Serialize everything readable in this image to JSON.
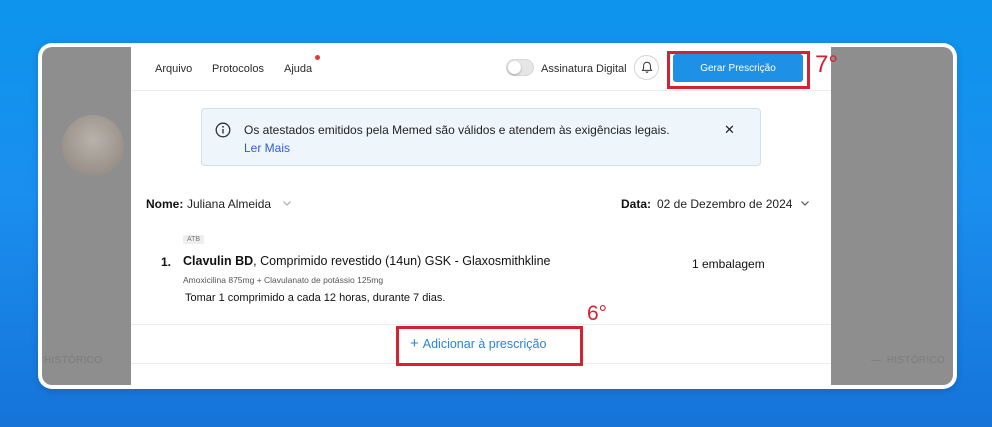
{
  "background": {
    "left_label": "HISTÓRICO",
    "right_label": "HISTÓRICO",
    "right_dash": "—"
  },
  "header": {
    "menu": [
      {
        "label": "Arquivo"
      },
      {
        "label": "Protocolos"
      },
      {
        "label": "Ajuda",
        "notification": true
      }
    ],
    "signature_label": "Assinatura Digital",
    "signature_enabled": false,
    "bell_icon": "bell-icon",
    "generate_button": "Gerar Prescrição"
  },
  "banner": {
    "icon": "info-icon",
    "message": "Os atestados emitidos pela Memed são válidos e atendem às exigências legais.",
    "link": "Ler Mais",
    "close": "✕"
  },
  "patient": {
    "name_label": "Nome:",
    "name_value": "Juliana Almeida",
    "date_label": "Data:",
    "date_value": "02 de Dezembro de 2024"
  },
  "prescription": {
    "items": [
      {
        "badge": "ATB",
        "number": "1.",
        "name": "Clavulin BD",
        "description": ", Comprimido revestido (14un) GSK - Glaxosmithkline",
        "quantity": "1 embalagem",
        "composition": "Amoxicilina 875mg + Clavulanato de potássio 125mg",
        "instructions": "Tomar 1 comprimido a cada 12 horas, durante 7 dias."
      }
    ],
    "add_button": "Adicionar à prescrição"
  },
  "annotations": {
    "step_generate": "7°",
    "step_add": "6°",
    "color": "#d32330"
  },
  "colors": {
    "primary": "#1e90e6",
    "link": "#2f5fcf",
    "banner_bg": "#eef5fb"
  }
}
